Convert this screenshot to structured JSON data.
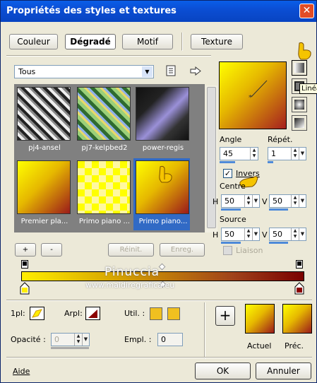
{
  "window": {
    "title": "Propriétés des styles et textures",
    "close": "✕"
  },
  "tabs": [
    {
      "label": "Couleur",
      "active": false
    },
    {
      "label": "Dégradé",
      "active": true
    },
    {
      "label": "Motif",
      "active": false
    },
    {
      "label": "Texture",
      "active": false
    }
  ],
  "gallery": {
    "filter": "Tous",
    "items": [
      {
        "caption": "pj4-ansel",
        "selected": false
      },
      {
        "caption": "pj7-kelpbed2",
        "selected": false
      },
      {
        "caption": "power-regis",
        "selected": false
      },
      {
        "caption": "Premier pla...",
        "selected": false
      },
      {
        "caption": "Primo piano ...",
        "selected": false
      },
      {
        "caption": "Primo piano...",
        "selected": true
      }
    ]
  },
  "buttons": {
    "plus": "+",
    "minus": "-",
    "reinit": "Réinit.",
    "enreg": "Enreg.",
    "ok": "OK",
    "annuler": "Annuler",
    "add": "+"
  },
  "settings": {
    "angle_label": "Angle",
    "angle_value": "45",
    "repet_label": "Répét.",
    "repet_value": "1",
    "invers_label": "Invers",
    "invers_checked": true,
    "centre_label": "Centre",
    "h_label": "H",
    "v_label": "V",
    "centre_h": "50",
    "centre_v": "50",
    "source_label": "Source",
    "source_h": "50",
    "source_v": "50",
    "liaison_label": "Liaison"
  },
  "tooltip": "Linéa",
  "watermark": {
    "line1": "Pinuccia",
    "line2": "www.maidiregrafica.eu"
  },
  "bottom": {
    "label_1pl": "1pl:",
    "label_arpl": "Arpl:",
    "label_util": "Util. :",
    "opacite_label": "Opacité :",
    "opacite_value": "0",
    "empl_label": "Empl. :",
    "empl_value": "0",
    "actuel_label": "Actuel",
    "prec_label": "Préc.",
    "aide": "Aide"
  },
  "colors": {
    "fg": "#ffff00",
    "bg": "#8b0000",
    "util1": "#f0c020",
    "util2": "#f0c020",
    "selection": "#316ac5"
  }
}
